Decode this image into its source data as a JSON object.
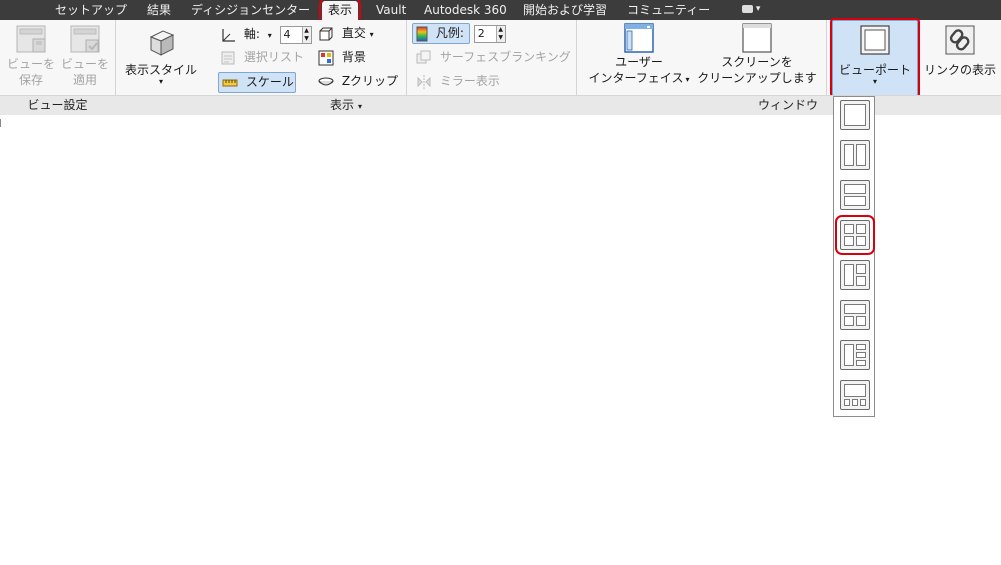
{
  "tabs": [
    {
      "label": "セットアップ",
      "active": false
    },
    {
      "label": "結果",
      "active": false
    },
    {
      "label": "ディシジョンセンター",
      "active": false
    },
    {
      "label": "表示",
      "active": true
    },
    {
      "label": "Vault",
      "active": false
    },
    {
      "label": "Autodesk 360",
      "active": false
    },
    {
      "label": "開始および学習",
      "active": false
    },
    {
      "label": "コミュニティー",
      "active": false
    }
  ],
  "view_settings": {
    "save_view": [
      "ビューを",
      "保存"
    ],
    "apply_view": [
      "ビューを",
      "適用"
    ],
    "panel_label": "ビュー設定"
  },
  "display": {
    "display_style": "表示スタイル",
    "axis_label": "軸:",
    "axis_value": "4",
    "orthographic": "直交",
    "select_list": "選択リスト",
    "background": "背景",
    "scale": "スケール",
    "zclip": "Zクリップ",
    "legend_label": "凡例:",
    "legend_value": "2",
    "surface_blanking": "サーフェスブランキング",
    "mirror_display": "ミラー表示",
    "panel_label": "表示"
  },
  "window": {
    "user_interface": [
      "ユーザー",
      "インターフェイス"
    ],
    "clean_screen": [
      "スクリーンを",
      "クリーンアップします"
    ],
    "viewport": "ビューポート",
    "show_links": "リンクの表示",
    "panel_label": "ウィンドウ"
  },
  "viewport_menu": {
    "layouts": [
      "single",
      "two-vertical",
      "two-horizontal",
      "four",
      "three-left-big",
      "three-top-big",
      "four-left-big",
      "four-bottom-row"
    ],
    "highlighted_index": 3
  },
  "colors": {
    "tab_bar": "#3c3c3c",
    "highlight": "#d8000c",
    "selected_button": "#cfe2f6"
  }
}
